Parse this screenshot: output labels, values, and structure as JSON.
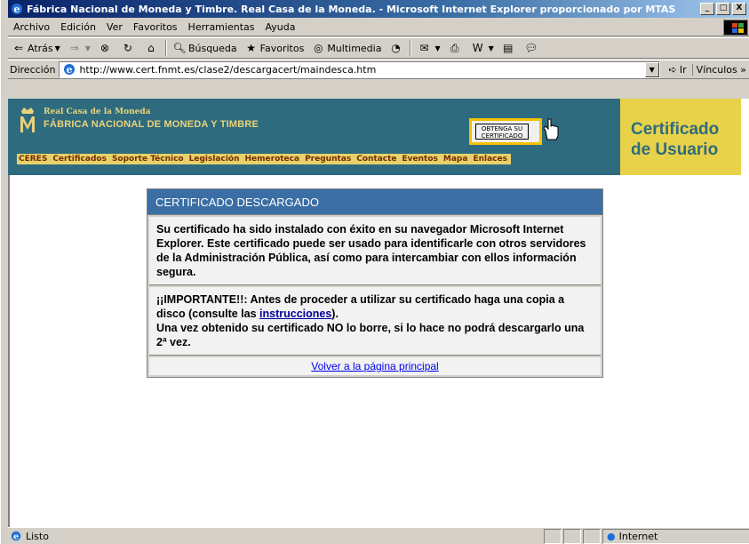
{
  "window": {
    "title": "Fábrica Nacional de Moneda y Timbre. Real Casa de la Moneda. - Microsoft Internet Explorer proporcionado por MTAS",
    "minimize": "_",
    "maximize": "□",
    "close": "X"
  },
  "menu": [
    {
      "label": "Archivo"
    },
    {
      "label": "Edición"
    },
    {
      "label": "Ver"
    },
    {
      "label": "Favoritos"
    },
    {
      "label": "Herramientas"
    },
    {
      "label": "Ayuda"
    }
  ],
  "toolbar": {
    "back": "Atrás",
    "search": "Búsqueda",
    "favorites": "Favoritos",
    "media": "Multimedia"
  },
  "address": {
    "label": "Dirección",
    "url": "http://www.cert.fnmt.es/clase2/descargacert/maindesca.htm",
    "go": "Ir",
    "links": "Vínculos"
  },
  "site": {
    "brand_small": "Real Casa de la Moneda",
    "brand_large": "FÁBRICA NACIONAL DE MONEDA Y TIMBRE",
    "nav": [
      "CERES",
      "Certificados",
      "Soporte Técnico",
      "Legislación",
      "Hemeroteca",
      "Preguntas",
      "Contacte",
      "Eventos",
      "Mapa",
      "Enlaces"
    ],
    "obtenga_line1": "OBTENGA SU",
    "obtenga_line2": "CERTIFICADO",
    "cert_line1": "Certificado",
    "cert_line2": "de Usuario"
  },
  "message": {
    "title": "CERTIFICADO DESCARGADO",
    "body1": "Su certificado ha sido instalado con éxito en su navegador Microsoft Internet Explorer. Este certificado puede ser usado para identificarle con otros servidores de la Administración Pública, así como para intercambiar con ellos información segura.",
    "body2_pre": "¡¡IMPORTANTE!!: Antes de proceder a utilizar su certificado haga una copia a disco (consulte las ",
    "body2_link": "instrucciones",
    "body2_post": ").",
    "body3": "Una vez obtenido su certificado NO lo borre, si lo hace no podrá descargarlo una 2ª vez.",
    "back_link": "Volver a la página principal"
  },
  "status": {
    "text": "Listo",
    "zone": "Internet"
  }
}
